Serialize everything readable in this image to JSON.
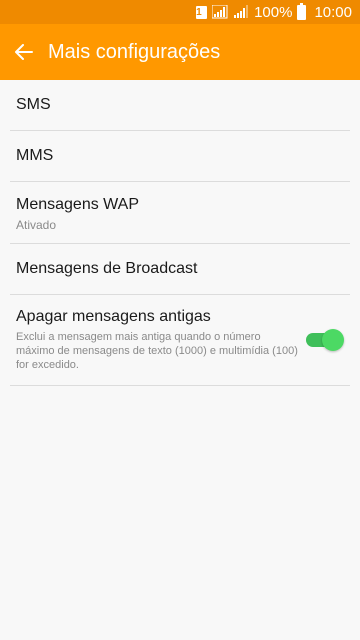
{
  "status_bar": {
    "sim_label": "1",
    "battery": "100%",
    "time": "10:00"
  },
  "app_bar": {
    "title": "Mais configurações",
    "back_icon": "arrow-left-icon"
  },
  "items": [
    {
      "title": "SMS"
    },
    {
      "title": "MMS"
    },
    {
      "title": "Mensagens WAP",
      "subtitle": "Ativado"
    },
    {
      "title": "Mensagens de Broadcast"
    },
    {
      "title": "Apagar mensagens antigas",
      "description": "Exclui a mensagem mais antiga quando o número máximo de mensagens de texto (1000) e multimídia (100) for excedido.",
      "toggle_on": true
    }
  ],
  "colors": {
    "status_bar": "#ef8a00",
    "app_bar": "#ff9800",
    "toggle_on": "#4cd964"
  }
}
